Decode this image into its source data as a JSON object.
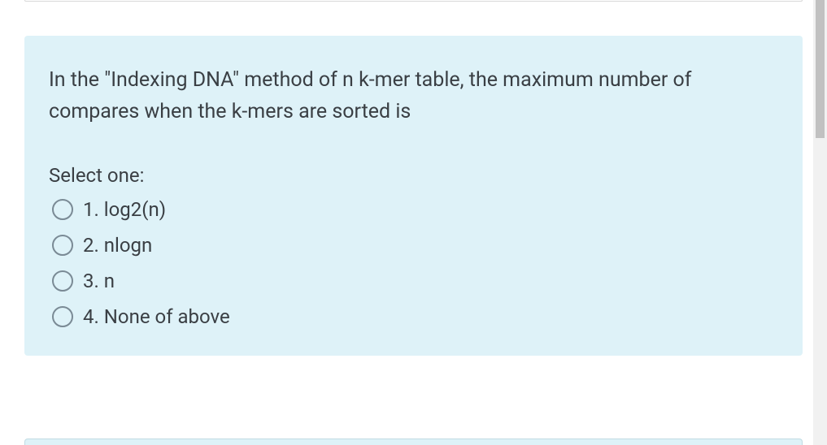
{
  "question": {
    "text": "In the \"Indexing DNA\" method of n k-mer table, the maximum number of compares when the k-mers are sorted is",
    "select_label": "Select one:",
    "options": [
      {
        "label": "1. log2(n)"
      },
      {
        "label": "2. nlogn"
      },
      {
        "label": "3. n"
      },
      {
        "label": "4. None of above"
      }
    ]
  }
}
